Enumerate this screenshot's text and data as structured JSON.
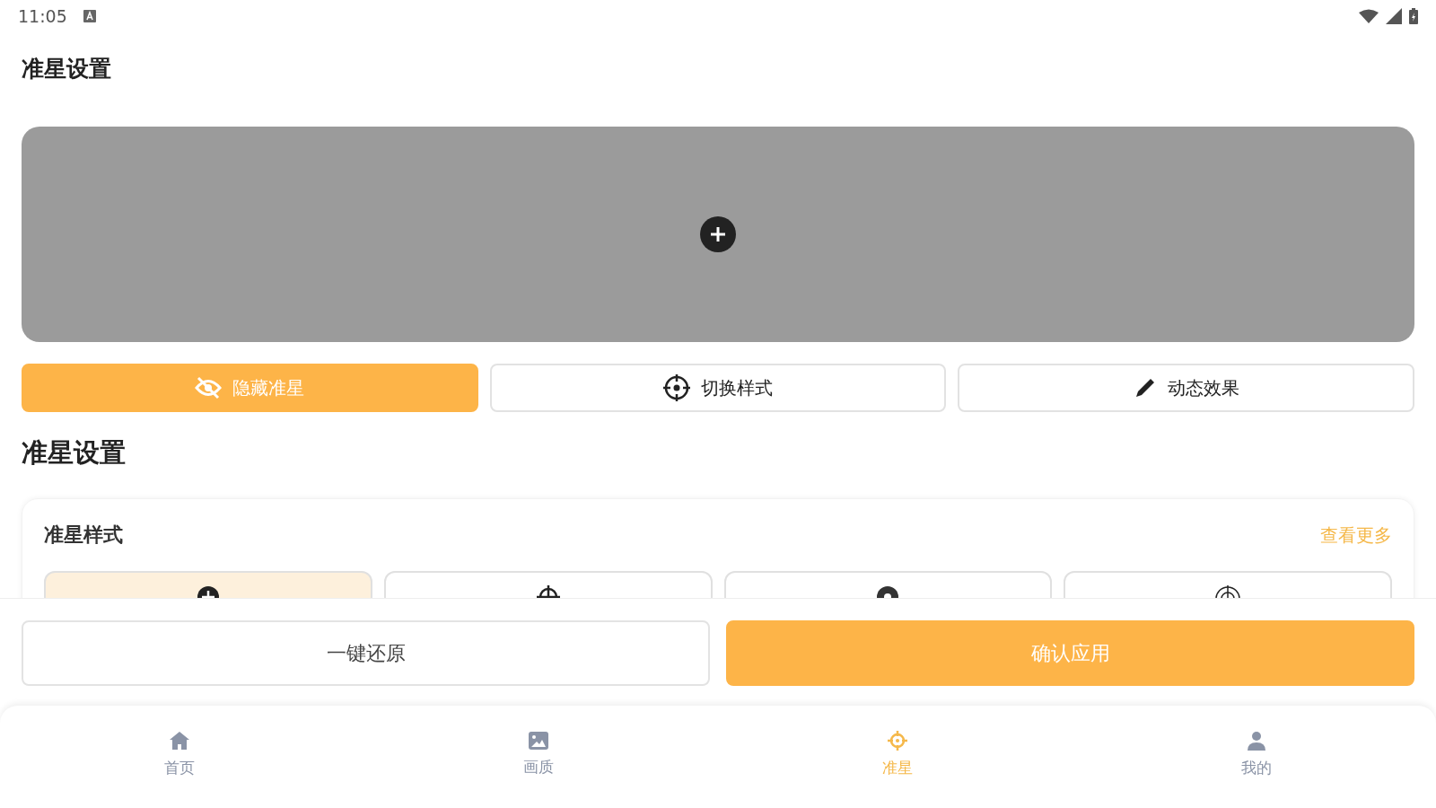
{
  "status_bar": {
    "time": "11:05"
  },
  "header": {
    "title": "准星设置"
  },
  "actions": [
    {
      "label": "隐藏准星",
      "selected": true
    },
    {
      "label": "切换样式",
      "selected": false
    },
    {
      "label": "动态效果",
      "selected": false
    }
  ],
  "section_title": "准星设置",
  "styles_card": {
    "title": "准星样式",
    "more_link": "查看更多",
    "styles": [
      {
        "selected": true
      },
      {
        "selected": false
      },
      {
        "selected": false
      },
      {
        "selected": false
      }
    ]
  },
  "footer_buttons": {
    "reset": "一键还原",
    "apply": "确认应用"
  },
  "nav": [
    {
      "label": "首页",
      "selected": false
    },
    {
      "label": "画质",
      "selected": false
    },
    {
      "label": "准星",
      "selected": true
    },
    {
      "label": "我的",
      "selected": false
    }
  ]
}
